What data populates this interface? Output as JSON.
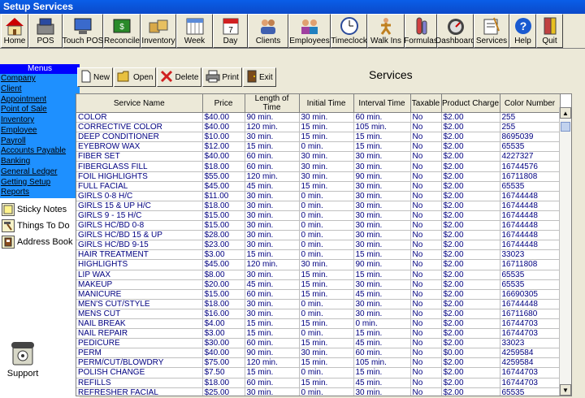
{
  "window": {
    "title": "Setup Services"
  },
  "toolbar": [
    {
      "label": "Home",
      "icon": "home-icon",
      "w": 34
    },
    {
      "label": "POS",
      "icon": "pos-icon",
      "w": 42
    },
    {
      "label": "Touch POS",
      "icon": "touch-pos-icon",
      "w": 50
    },
    {
      "label": "Reconcile",
      "icon": "reconcile-icon",
      "w": 46
    },
    {
      "label": "Inventory",
      "icon": "inventory-icon",
      "w": 44
    },
    {
      "label": "Week",
      "icon": "calendar-week-icon",
      "w": 45
    },
    {
      "label": "Day",
      "icon": "calendar-day-icon",
      "w": 43
    },
    {
      "label": "Clients",
      "icon": "clients-icon",
      "w": 50
    },
    {
      "label": "Employees",
      "icon": "employees-icon",
      "w": 52
    },
    {
      "label": "Timeclock",
      "icon": "clock-icon",
      "w": 45
    },
    {
      "label": "Walk Ins",
      "icon": "walk-ins-icon",
      "w": 46
    },
    {
      "label": "Formulas",
      "icon": "formulas-icon",
      "w": 40
    },
    {
      "label": "Dashboard",
      "icon": "dashboard-icon",
      "w": 45
    },
    {
      "label": "Services",
      "icon": "services-icon",
      "w": 44
    },
    {
      "label": "Help",
      "icon": "help-icon",
      "w": 33
    },
    {
      "label": "Quit",
      "icon": "quit-icon",
      "w": 33
    }
  ],
  "sidebar": {
    "header": "Menus",
    "items": [
      "Company",
      "Client",
      "Appointment",
      "Point of Sale",
      "Inventory",
      "Employee",
      "Payroll",
      "Accounts Payable",
      "Banking",
      "General Ledger",
      "Getting Setup",
      "Reports"
    ],
    "tools": [
      {
        "label": "Sticky Notes",
        "icon": "sticky-notes-icon"
      },
      {
        "label": "Things To Do",
        "icon": "hammer-icon"
      },
      {
        "label": "Address Book",
        "icon": "address-book-icon"
      }
    ],
    "support_label": "Support"
  },
  "actions": [
    {
      "label": "New",
      "icon": "new-document-icon"
    },
    {
      "label": "Open",
      "icon": "open-folder-icon"
    },
    {
      "label": "Delete",
      "icon": "delete-x-icon"
    },
    {
      "label": "Print",
      "icon": "printer-icon"
    },
    {
      "label": "Exit",
      "icon": "exit-door-icon"
    }
  ],
  "page_heading": "Services",
  "table": {
    "columns": [
      "Service Name",
      "Price",
      "Length of Time",
      "Initial Time",
      "Interval Time",
      "Taxable",
      "Product Charge",
      "Color Number"
    ],
    "rows": [
      [
        "COLOR",
        "$40.00",
        "90 min.",
        "30 min.",
        "60 min.",
        "No",
        "$2.00",
        "255"
      ],
      [
        "CORRECTIVE COLOR",
        "$40.00",
        "120 min.",
        "15 min.",
        "105 min.",
        "No",
        "$2.00",
        "255"
      ],
      [
        "DEEP CONDITIONER",
        "$10.00",
        "30 min.",
        "15 min.",
        "15 min.",
        "No",
        "$2.00",
        "8695039"
      ],
      [
        "EYEBROW WAX",
        "$12.00",
        "15 min.",
        "0 min.",
        "15 min.",
        "No",
        "$2.00",
        "65535"
      ],
      [
        "FIBER SET",
        "$40.00",
        "60 min.",
        "30 min.",
        "30 min.",
        "No",
        "$2.00",
        "4227327"
      ],
      [
        "FIBERGLASS FILL",
        "$18.00",
        "60 min.",
        "30 min.",
        "30 min.",
        "No",
        "$2.00",
        "16744576"
      ],
      [
        "FOIL HIGHLIGHTS",
        "$55.00",
        "120 min.",
        "30 min.",
        "90 min.",
        "No",
        "$2.00",
        "16711808"
      ],
      [
        "FULL FACIAL",
        "$45.00",
        "45 min.",
        "15 min.",
        "30 min.",
        "No",
        "$2.00",
        "65535"
      ],
      [
        "GIRLS 0-8 H/C",
        "$11.00",
        "30 min.",
        "0 min.",
        "30 min.",
        "No",
        "$2.00",
        "16744448"
      ],
      [
        "GIRLS 15 &  UP H/C",
        "$18.00",
        "30 min.",
        "0 min.",
        "30 min.",
        "No",
        "$2.00",
        "16744448"
      ],
      [
        "GIRLS 9 - 15 H/C",
        "$15.00",
        "30 min.",
        "0 min.",
        "30 min.",
        "No",
        "$2.00",
        "16744448"
      ],
      [
        "GIRLS HC/BD 0-8",
        "$15.00",
        "30 min.",
        "0 min.",
        "30 min.",
        "No",
        "$2.00",
        "16744448"
      ],
      [
        "GIRLS HC/BD 15 & UP",
        "$28.00",
        "30 min.",
        "0 min.",
        "30 min.",
        "No",
        "$2.00",
        "16744448"
      ],
      [
        "GIRLS HC/BD 9-15",
        "$23.00",
        "30 min.",
        "0 min.",
        "30 min.",
        "No",
        "$2.00",
        "16744448"
      ],
      [
        "HAIR TREATMENT",
        "$3.00",
        "15 min.",
        "0 min.",
        "15 min.",
        "No",
        "$2.00",
        "33023"
      ],
      [
        "HIGHLIGHTS",
        "$45.00",
        "120 min.",
        "30 min.",
        "90 min.",
        "No",
        "$2.00",
        "16711808"
      ],
      [
        "LIP WAX",
        "$8.00",
        "30 min.",
        "15 min.",
        "15 min.",
        "No",
        "$2.00",
        "65535"
      ],
      [
        "MAKEUP",
        "$20.00",
        "45 min.",
        "15 min.",
        "30 min.",
        "No",
        "$2.00",
        "65535"
      ],
      [
        "MANICURE",
        "$15.00",
        "60 min.",
        "15 min.",
        "45 min.",
        "No",
        "$2.00",
        "16690305"
      ],
      [
        "MEN'S CUT/STYLE",
        "$18.00",
        "30 min.",
        "0 min.",
        "30 min.",
        "No",
        "$2.00",
        "16744448"
      ],
      [
        "MENS CUT",
        "$16.00",
        "30 min.",
        "0 min.",
        "30 min.",
        "No",
        "$2.00",
        "16711680"
      ],
      [
        "NAIL BREAK",
        "$4.00",
        "15 min.",
        "15 min.",
        "0 min.",
        "No",
        "$2.00",
        "16744703"
      ],
      [
        "NAIL REPAIR",
        "$3.00",
        "15 min.",
        "0 min.",
        "15 min.",
        "No",
        "$2.00",
        "16744703"
      ],
      [
        "PEDICURE",
        "$30.00",
        "60 min.",
        "15 min.",
        "45 min.",
        "No",
        "$2.00",
        "33023"
      ],
      [
        "PERM",
        "$40.00",
        "90 min.",
        "30 min.",
        "60 min.",
        "No",
        "$0.00",
        "4259584"
      ],
      [
        "PERM/CUT/BLOWDRY",
        "$75.00",
        "120 min.",
        "15 min.",
        "105 min.",
        "No",
        "$2.00",
        "4259584"
      ],
      [
        "POLISH CHANGE",
        "$7.50",
        "15 min.",
        "0 min.",
        "15 min.",
        "No",
        "$2.00",
        "16744703"
      ],
      [
        "REFILLS",
        "$18.00",
        "60 min.",
        "15 min.",
        "45 min.",
        "No",
        "$2.00",
        "16744703"
      ],
      [
        "REFRESHER FACIAL",
        "$25.00",
        "30 min.",
        "0 min.",
        "30 min.",
        "No",
        "$2.00",
        "65535"
      ]
    ]
  }
}
